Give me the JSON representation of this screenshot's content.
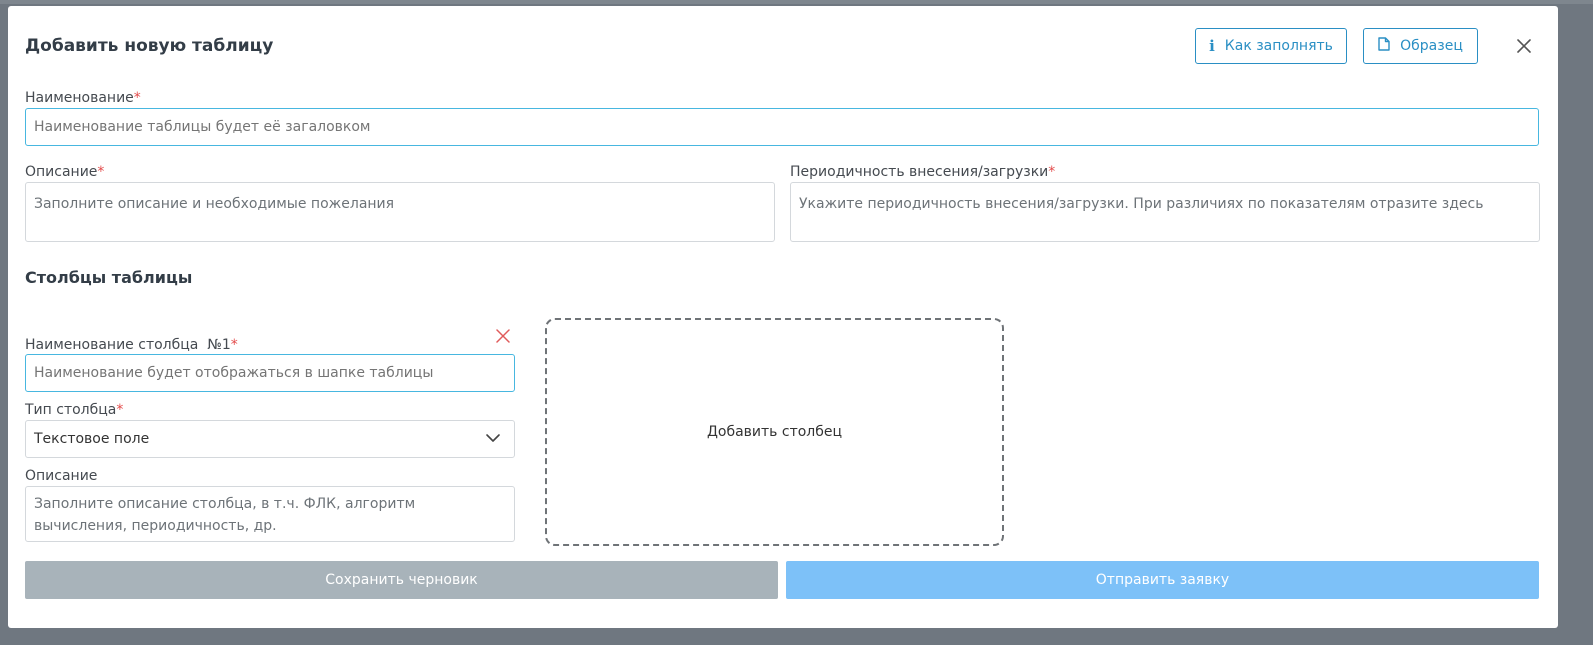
{
  "modal": {
    "title": "Добавить новую таблицу",
    "how_to_fill_label": "Как заполнять",
    "sample_label": "Образец"
  },
  "name_field": {
    "label": "Наименование",
    "required_mark": "*",
    "placeholder": "Наименование таблицы будет её загаловком"
  },
  "description_field": {
    "label": "Описание",
    "required_mark": "*",
    "placeholder": "Заполните описание и необходимые пожелания"
  },
  "periodicity_field": {
    "label": "Периодичность внесения/загрузки",
    "required_mark": "*",
    "placeholder": "Укажите периодичность внесения/загрузки. При различиях по показателям отразите здесь"
  },
  "columns_section": {
    "title": "Столбцы таблицы",
    "column1": {
      "name_label": "Наименование столбца  №1",
      "required_mark": "*",
      "name_placeholder": "Наименование будет отображаться в шапке таблицы",
      "type_label": "Тип столбца",
      "type_required_mark": "*",
      "type_value": "Текстовое поле",
      "desc_label": "Описание",
      "desc_placeholder": "Заполните описание столбца, в т.ч. ФЛК, алгоритм вычисления, периодичность, др."
    },
    "add_column_label": "Добавить столбец"
  },
  "footer": {
    "save_draft_label": "Сохранить черновик",
    "submit_label": "Отправить заявку"
  },
  "icons": {
    "info": "info-icon",
    "document": "document-icon",
    "close": "close-icon",
    "delete": "delete-column-icon",
    "chevron": "chevron-down-icon"
  },
  "colors": {
    "accent": "#2a8fc4",
    "focus_border": "#47b7e0",
    "required": "#e34a4a",
    "draft_button": "#a8b3ba",
    "submit_button": "#7dc1f8"
  }
}
